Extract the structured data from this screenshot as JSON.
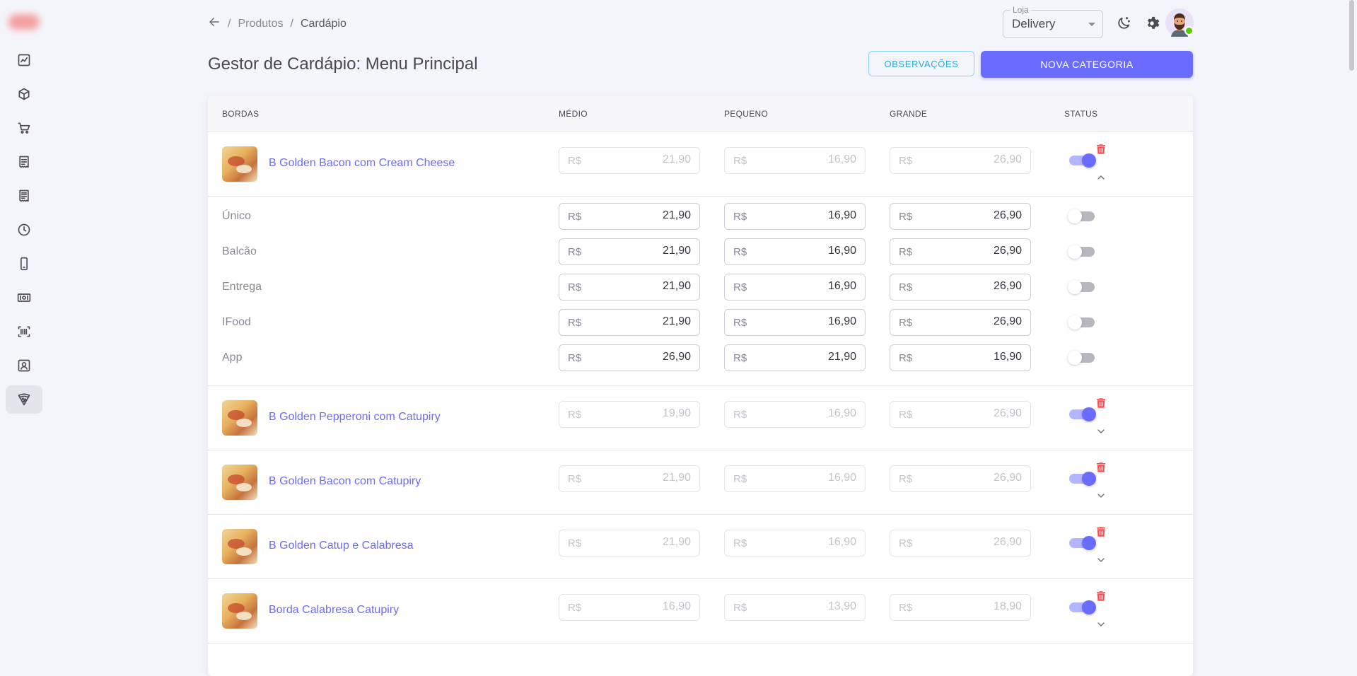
{
  "header": {
    "breadcrumb": [
      "Produtos",
      "Cardápio"
    ],
    "breadcrumb_sep": "/",
    "store_label": "Loja",
    "store_value": "Delivery",
    "page_title": "Gestor de Cardápio: Menu Principal",
    "btn_observacoes": "OBSERVAÇÕES",
    "btn_nova_categoria": "NOVA CATEGORIA"
  },
  "sidebar": {
    "items": [
      {
        "icon": "chart-line-icon"
      },
      {
        "icon": "cube-icon"
      },
      {
        "icon": "cart-icon"
      },
      {
        "icon": "receipt-icon"
      },
      {
        "icon": "receipt-list-icon"
      },
      {
        "icon": "clock-icon"
      },
      {
        "icon": "cellphone-icon"
      },
      {
        "icon": "cash-icon"
      },
      {
        "icon": "barcode-scan-icon"
      },
      {
        "icon": "account-box-icon"
      },
      {
        "icon": "pizza-icon",
        "active": true
      }
    ]
  },
  "table": {
    "columns": [
      "BORDAS",
      "MÉDIO",
      "PEQUENO",
      "GRANDE",
      "STATUS"
    ],
    "currency": "R$",
    "products": [
      {
        "name": "B Golden Bacon com Cream Cheese",
        "medio": "21,90",
        "pequeno": "16,90",
        "grande": "26,90",
        "status": true,
        "expanded": true,
        "channels": [
          {
            "label": "Único",
            "medio": "21,90",
            "pequeno": "16,90",
            "grande": "26,90",
            "status": false
          },
          {
            "label": "Balcão",
            "medio": "21,90",
            "pequeno": "16,90",
            "grande": "26,90",
            "status": false
          },
          {
            "label": "Entrega",
            "medio": "21,90",
            "pequeno": "16,90",
            "grande": "26,90",
            "status": false
          },
          {
            "label": "IFood",
            "medio": "21,90",
            "pequeno": "16,90",
            "grande": "26,90",
            "status": false
          },
          {
            "label": "App",
            "medio": "26,90",
            "pequeno": "21,90",
            "grande": "16,90",
            "status": false
          }
        ]
      },
      {
        "name": "B Golden Pepperoni com Catupiry",
        "medio": "19,90",
        "pequeno": "16,90",
        "grande": "26,90",
        "status": true,
        "expanded": false
      },
      {
        "name": "B Golden Bacon com Catupiry",
        "medio": "21,90",
        "pequeno": "16,90",
        "grande": "26,90",
        "status": true,
        "expanded": false
      },
      {
        "name": "B Golden Catup e Calabresa",
        "medio": "21,90",
        "pequeno": "16,90",
        "grande": "26,90",
        "status": true,
        "expanded": false
      },
      {
        "name": "Borda Calabresa Catupiry",
        "medio": "16,90",
        "pequeno": "13,90",
        "grande": "18,90",
        "status": true,
        "expanded": false
      }
    ]
  }
}
